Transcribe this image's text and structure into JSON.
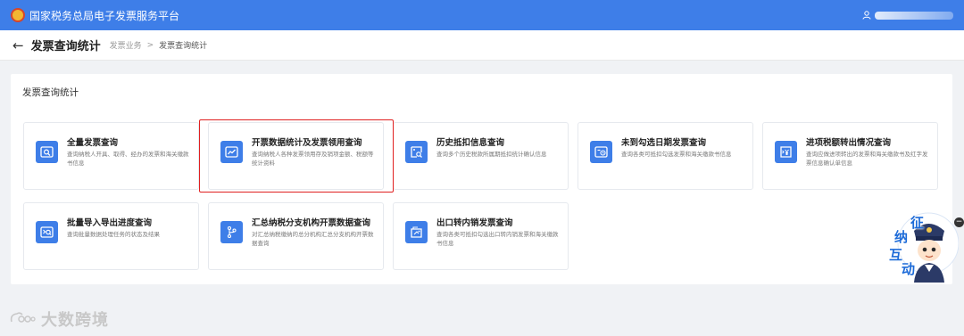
{
  "header": {
    "site_title": "国家税务总局电子发票服务平台"
  },
  "subheader": {
    "title": "发票查询统计",
    "breadcrumb": [
      "发票业务",
      "发票查询统计"
    ]
  },
  "panel": {
    "title": "发票查询统计",
    "cards": [
      {
        "title": "全量发票查询",
        "desc": "查询纳税人开具、取得、经办的发票和海关缴款书信息",
        "icon": "search-doc-icon"
      },
      {
        "title": "开票数据统计及发票领用查询",
        "desc": "查询纳税人各种发票领用存及销项金额、税额等统计资料",
        "icon": "trend-chart-icon"
      },
      {
        "title": "历史抵扣信息查询",
        "desc": "查询多个历史税款所属期抵扣统计确认信息",
        "icon": "image-search-icon"
      },
      {
        "title": "未到勾选日期发票查询",
        "desc": "查询各类可抵扣勾选发票和海关缴款书信息",
        "icon": "clock-doc-icon"
      },
      {
        "title": "进项税额转出情况查询",
        "desc": "查询应做进项转出的发票和海关缴款书及红字发票信息确认单信息",
        "icon": "tax-transfer-icon"
      },
      {
        "title": "批量导入导出进度查询",
        "desc": "查询批量数据处理任务的状态及结果",
        "icon": "progress-search-icon"
      },
      {
        "title": "汇总纳税分支机构开票数据查询",
        "desc": "对汇总纳税缴纳的总分机构汇总分支机构开票数据查询",
        "icon": "branch-icon"
      },
      {
        "title": "出口转内销发票查询",
        "desc": "查询各类可抵扣勾选出口转内销发票和海关缴款书信息",
        "icon": "export-doc-icon"
      }
    ]
  },
  "mascot": {
    "chars": [
      "征",
      "纳",
      "互",
      "动"
    ]
  },
  "watermark": {
    "text": "大数跨境"
  },
  "colors": {
    "brand_blue": "#3e7ee8",
    "highlight_red": "#e02020"
  }
}
